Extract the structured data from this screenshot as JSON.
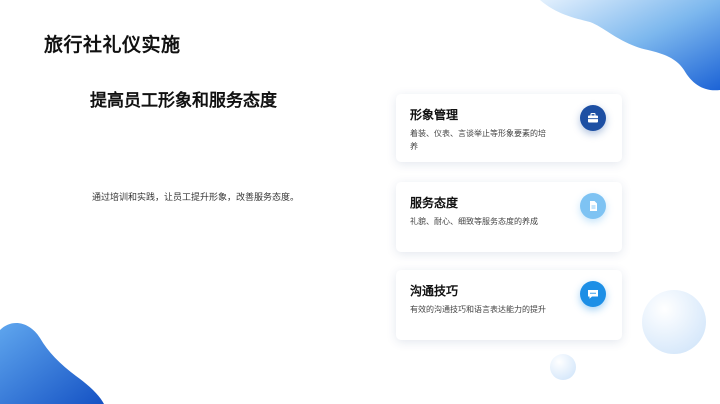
{
  "slide": {
    "title": "旅行社礼仪实施",
    "subtitle": "提高员工形象和服务态度",
    "description": "通过培训和实践，让员工提升形象，改善服务态度。"
  },
  "cards": [
    {
      "title": "形象管理",
      "text": "着装、仪表、言谈举止等形象要素的培养",
      "icon": "briefcase-icon",
      "color": "#1d4fa3"
    },
    {
      "title": "服务态度",
      "text": "礼貌、耐心、细致等服务态度的养成",
      "icon": "document-icon",
      "color": "#7ec3f3"
    },
    {
      "title": "沟通技巧",
      "text": "有效的沟通技巧和语言表达能力的提升",
      "icon": "chat-icon",
      "color": "#1d8fe6"
    }
  ],
  "colors": {
    "accent_dark": "#1d4fa3",
    "accent_light": "#7ec3f3",
    "accent_mid": "#1d8fe6"
  }
}
